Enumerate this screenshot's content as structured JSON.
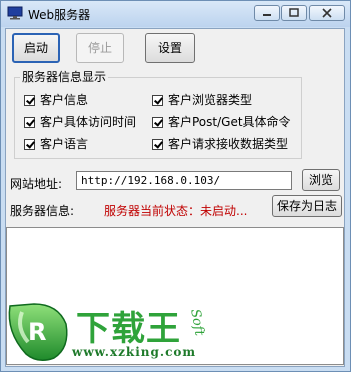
{
  "window": {
    "title": "Web服务器",
    "app_icon": "monitor-icon"
  },
  "caption_buttons": {
    "minimize": "minimize-icon",
    "maximize": "maximize-icon",
    "close": "close-icon"
  },
  "toolbar": {
    "start_label": "启动",
    "stop_label": "停止",
    "settings_label": "设置"
  },
  "info_group": {
    "caption": "服务器信息显示",
    "options": [
      {
        "label": "客户信息",
        "checked": true
      },
      {
        "label": "客户浏览器类型",
        "checked": true
      },
      {
        "label": "客户具体访问时间",
        "checked": true
      },
      {
        "label": "客户Post/Get具体命令",
        "checked": true
      },
      {
        "label": "客户语言",
        "checked": true
      },
      {
        "label": "客户请求接收数据类型",
        "checked": true
      }
    ]
  },
  "address": {
    "label": "网站地址:",
    "value": "http://192.168.0.103/",
    "browse_label": "浏览"
  },
  "server_info": {
    "label": "服务器信息:",
    "status": "服务器当前状态：未启动...",
    "save_label": "保存为日志"
  },
  "log": {
    "text": ""
  },
  "watermark": {
    "logo_text": "下载王",
    "url": "www.xzking.com",
    "soft": "Soft"
  }
}
